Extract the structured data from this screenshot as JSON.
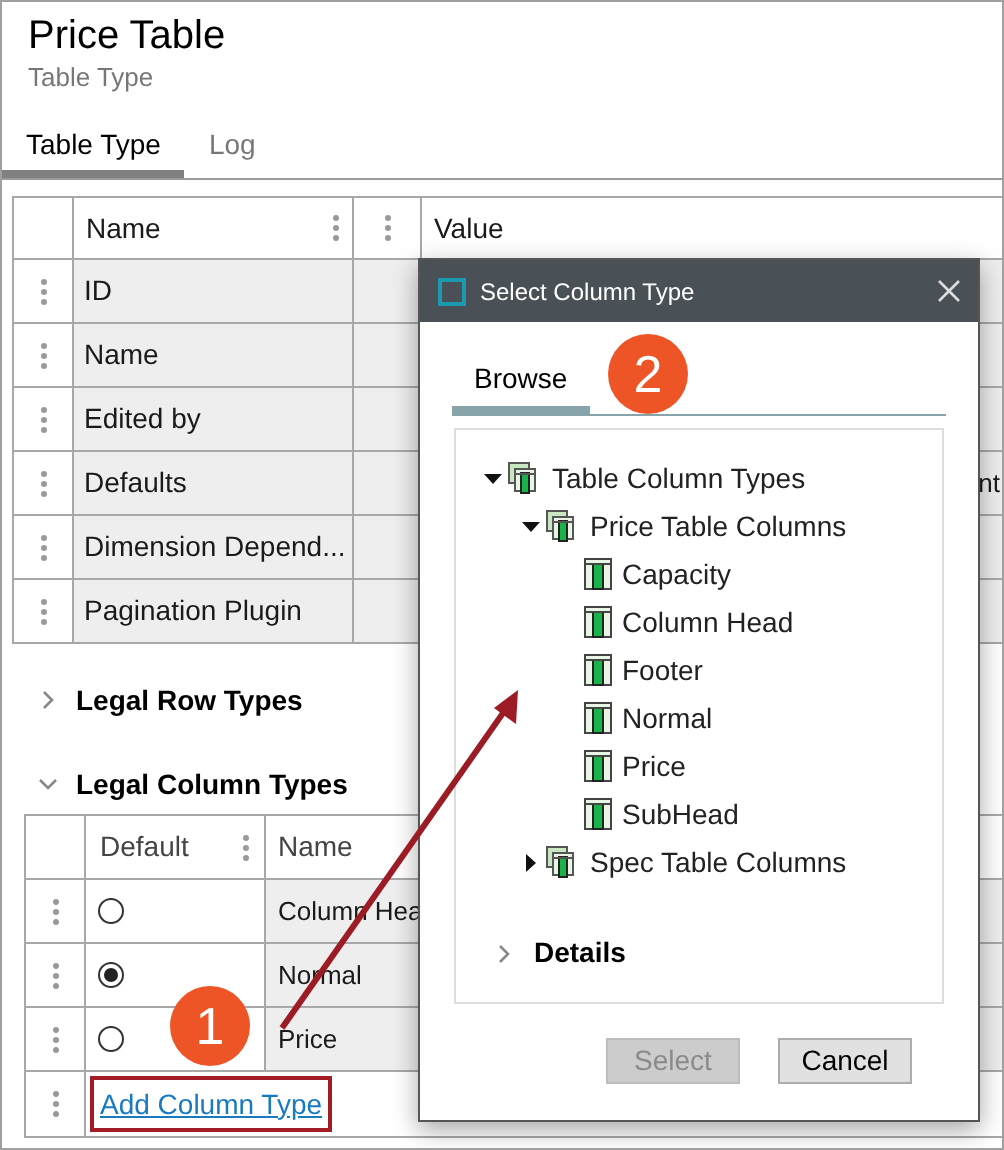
{
  "header": {
    "title": "Price Table",
    "subtitle": "Table Type"
  },
  "tabs": [
    {
      "label": "Table Type",
      "selected": true
    },
    {
      "label": "Log",
      "selected": false
    }
  ],
  "properties": {
    "columns": [
      "Name",
      "Value"
    ],
    "rows": [
      {
        "name": "ID"
      },
      {
        "name": "Name"
      },
      {
        "name": "Edited by"
      },
      {
        "name": "Defaults",
        "value": "nt"
      },
      {
        "name": "Dimension Depend..."
      },
      {
        "name": "Pagination Plugin"
      }
    ]
  },
  "sections": [
    {
      "title": "Legal Row Types",
      "expanded": false
    },
    {
      "title": "Legal Column Types",
      "expanded": true
    }
  ],
  "column_types_table": {
    "columns": [
      "Default",
      "Name"
    ],
    "rows": [
      {
        "name": "Column Hea",
        "selected": false
      },
      {
        "name": "Normal",
        "selected": true
      },
      {
        "name": "Price",
        "selected": false
      }
    ],
    "add_link": "Add Column Type"
  },
  "dialog": {
    "title": "Select Column Type",
    "tabs": [
      {
        "label": "Browse",
        "selected": true
      }
    ],
    "tree": [
      {
        "label": "Table Column Types",
        "kind": "folder",
        "expanded": true,
        "children": [
          {
            "label": "Price Table Columns",
            "kind": "folder",
            "expanded": true,
            "children": [
              {
                "label": "Capacity",
                "kind": "column"
              },
              {
                "label": "Column Head",
                "kind": "column"
              },
              {
                "label": "Footer",
                "kind": "column"
              },
              {
                "label": "Normal",
                "kind": "column"
              },
              {
                "label": "Price",
                "kind": "column"
              },
              {
                "label": "SubHead",
                "kind": "column"
              }
            ]
          },
          {
            "label": "Spec Table Columns",
            "kind": "folder",
            "expanded": false
          }
        ]
      }
    ],
    "details": {
      "label": "Details",
      "expanded": false
    },
    "buttons": [
      {
        "label": "Select",
        "disabled": true
      },
      {
        "label": "Cancel",
        "disabled": false
      }
    ]
  },
  "annotations": [
    {
      "label": "1"
    },
    {
      "label": "2"
    }
  ]
}
